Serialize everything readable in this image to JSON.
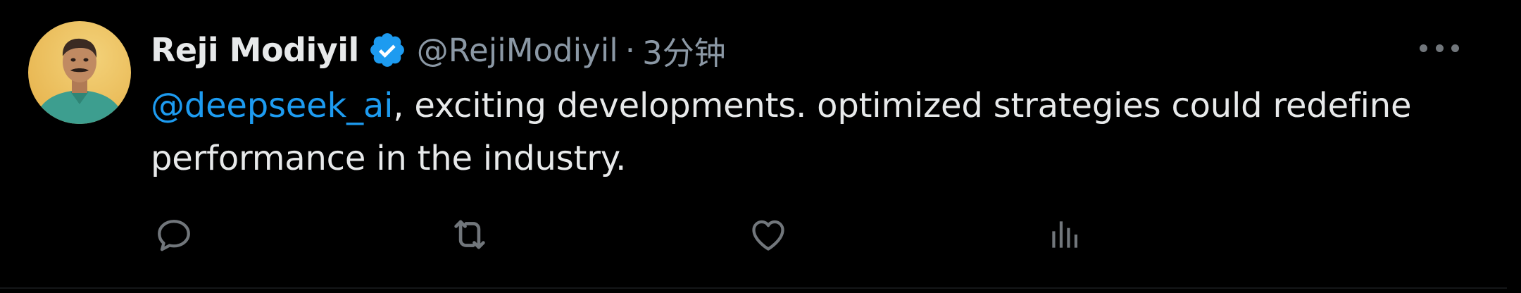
{
  "post": {
    "author_name": "Reji Modiyil",
    "handle": "@RejiModiyil",
    "separator": "·",
    "time": "3分钟",
    "mention": "@deepseek_ai",
    "body": ", exciting developments. optimized strategies could redefine performance in the industry."
  },
  "icons": {
    "verified": "verified-badge-icon",
    "more": "more-options-icon",
    "reply": "reply-icon",
    "repost": "repost-icon",
    "like": "like-icon",
    "views": "views-icon"
  },
  "colors": {
    "background": "#000000",
    "text": "#e7e9ea",
    "secondary": "#8b98a5",
    "accent": "#1d9bf0"
  }
}
